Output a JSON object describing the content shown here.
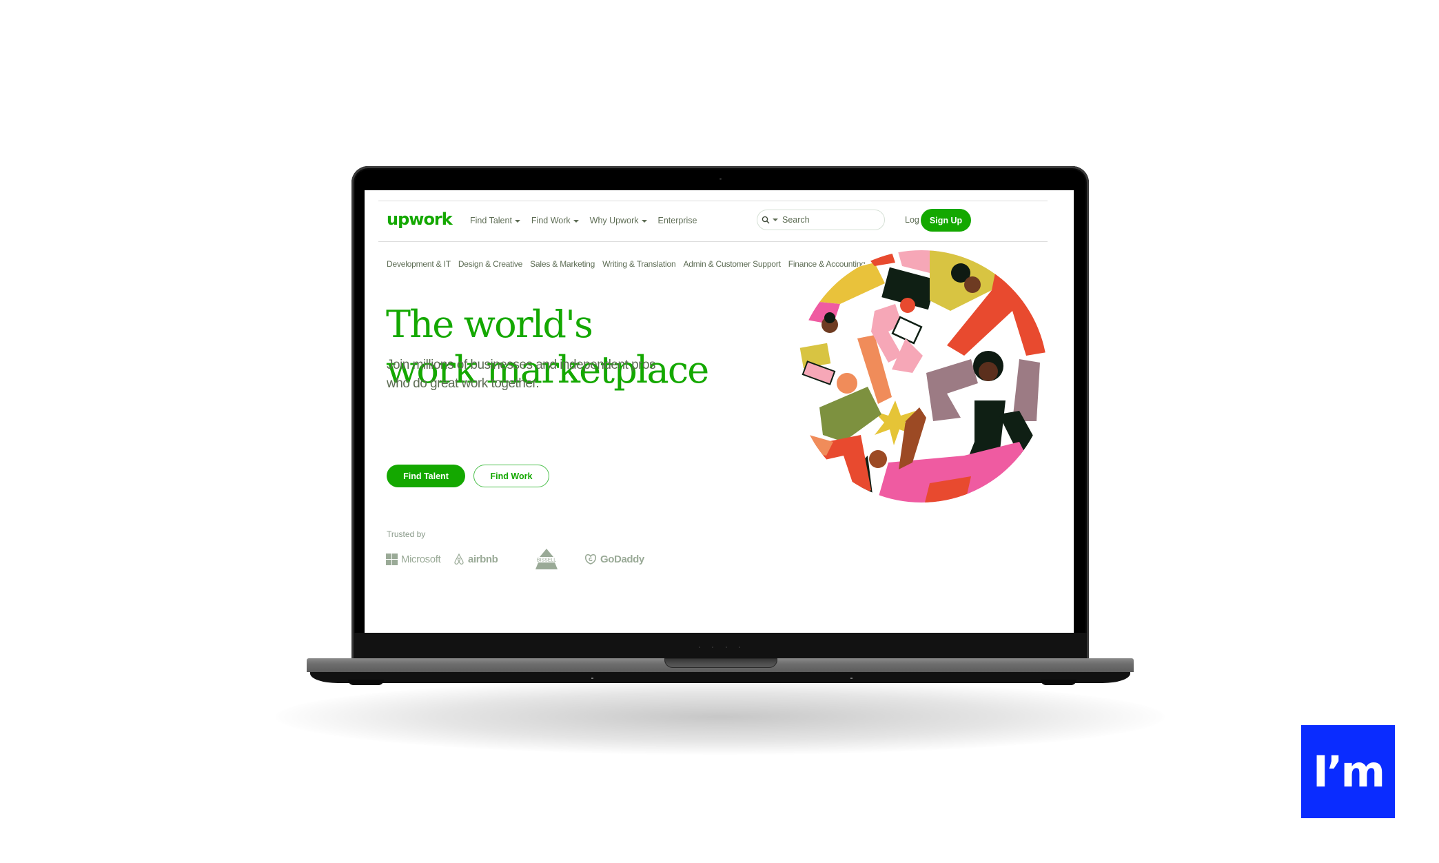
{
  "header": {
    "logo": "upwork",
    "nav": [
      {
        "label": "Find Talent",
        "has_dropdown": true
      },
      {
        "label": "Find Work",
        "has_dropdown": true
      },
      {
        "label": "Why Upwork",
        "has_dropdown": true
      },
      {
        "label": "Enterprise",
        "has_dropdown": false
      }
    ],
    "search": {
      "placeholder": "Search",
      "icon": "search-icon"
    },
    "login_label": "Log In",
    "signup_label": "Sign Up"
  },
  "categories": [
    "Development & IT",
    "Design & Creative",
    "Sales & Marketing",
    "Writing & Translation",
    "Admin & Customer Support",
    "Finance & Accounting"
  ],
  "hero": {
    "headline_line1": "The world's",
    "headline_line2": "work marketplace",
    "subtitle_line1": "Join millions of businesses and independent pros",
    "subtitle_line2": "who do great work together.",
    "primary_button": "Find Talent",
    "secondary_button": "Find Work",
    "trusted_label": "Trusted by",
    "trusted_logos": [
      "Microsoft",
      "airbnb",
      "BISSELL",
      "GoDaddy"
    ],
    "illustration": "people-collaborating-circle-illustration"
  },
  "badge": {
    "label": "I’m"
  },
  "colors": {
    "brand_green": "#14a800",
    "nav_text": "#5e6d55",
    "logo_gray": "#9aaa97",
    "badge_blue": "#0a2cff"
  }
}
